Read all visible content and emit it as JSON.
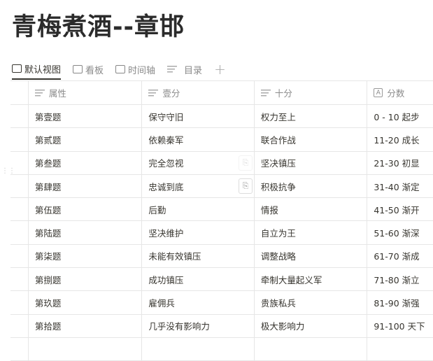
{
  "title": "青梅煮酒--章邯",
  "tabs": [
    {
      "label": "默认视图",
      "icon": "table-icon"
    },
    {
      "label": "看板",
      "icon": "board-icon"
    },
    {
      "label": "时间轴",
      "icon": "timeline-icon"
    },
    {
      "label": "目录",
      "icon": "list-icon"
    }
  ],
  "add_tab": "+",
  "columns": [
    "属性",
    "壹分",
    "十分",
    "分数"
  ],
  "rows": [
    [
      "第壹题",
      "保守守旧",
      "权力至上",
      "0 - 10 起步"
    ],
    [
      "第贰题",
      "依赖秦军",
      "联合作战",
      "11-20 成长"
    ],
    [
      "第叁题",
      "完全忽视",
      "坚决镇压",
      "21-30 初显"
    ],
    [
      "第肆题",
      "忠诚到底",
      "积极抗争",
      "31-40 渐定"
    ],
    [
      "第伍题",
      "后勤",
      "情报",
      "41-50 渐开"
    ],
    [
      "第陆题",
      "坚决维护",
      "自立为王",
      "51-60 渐深"
    ],
    [
      "第柒题",
      "未能有效镇压",
      "调整战略",
      "61-70 渐成"
    ],
    [
      "第捌题",
      "成功镇压",
      "牵制大量起义军",
      "71-80 渐立"
    ],
    [
      "第玖题",
      "雇佣兵",
      "贵族私兵",
      "81-90 渐强"
    ],
    [
      "第拾题",
      "几乎没有影响力",
      "极大影响力",
      "91-100 天下"
    ]
  ]
}
